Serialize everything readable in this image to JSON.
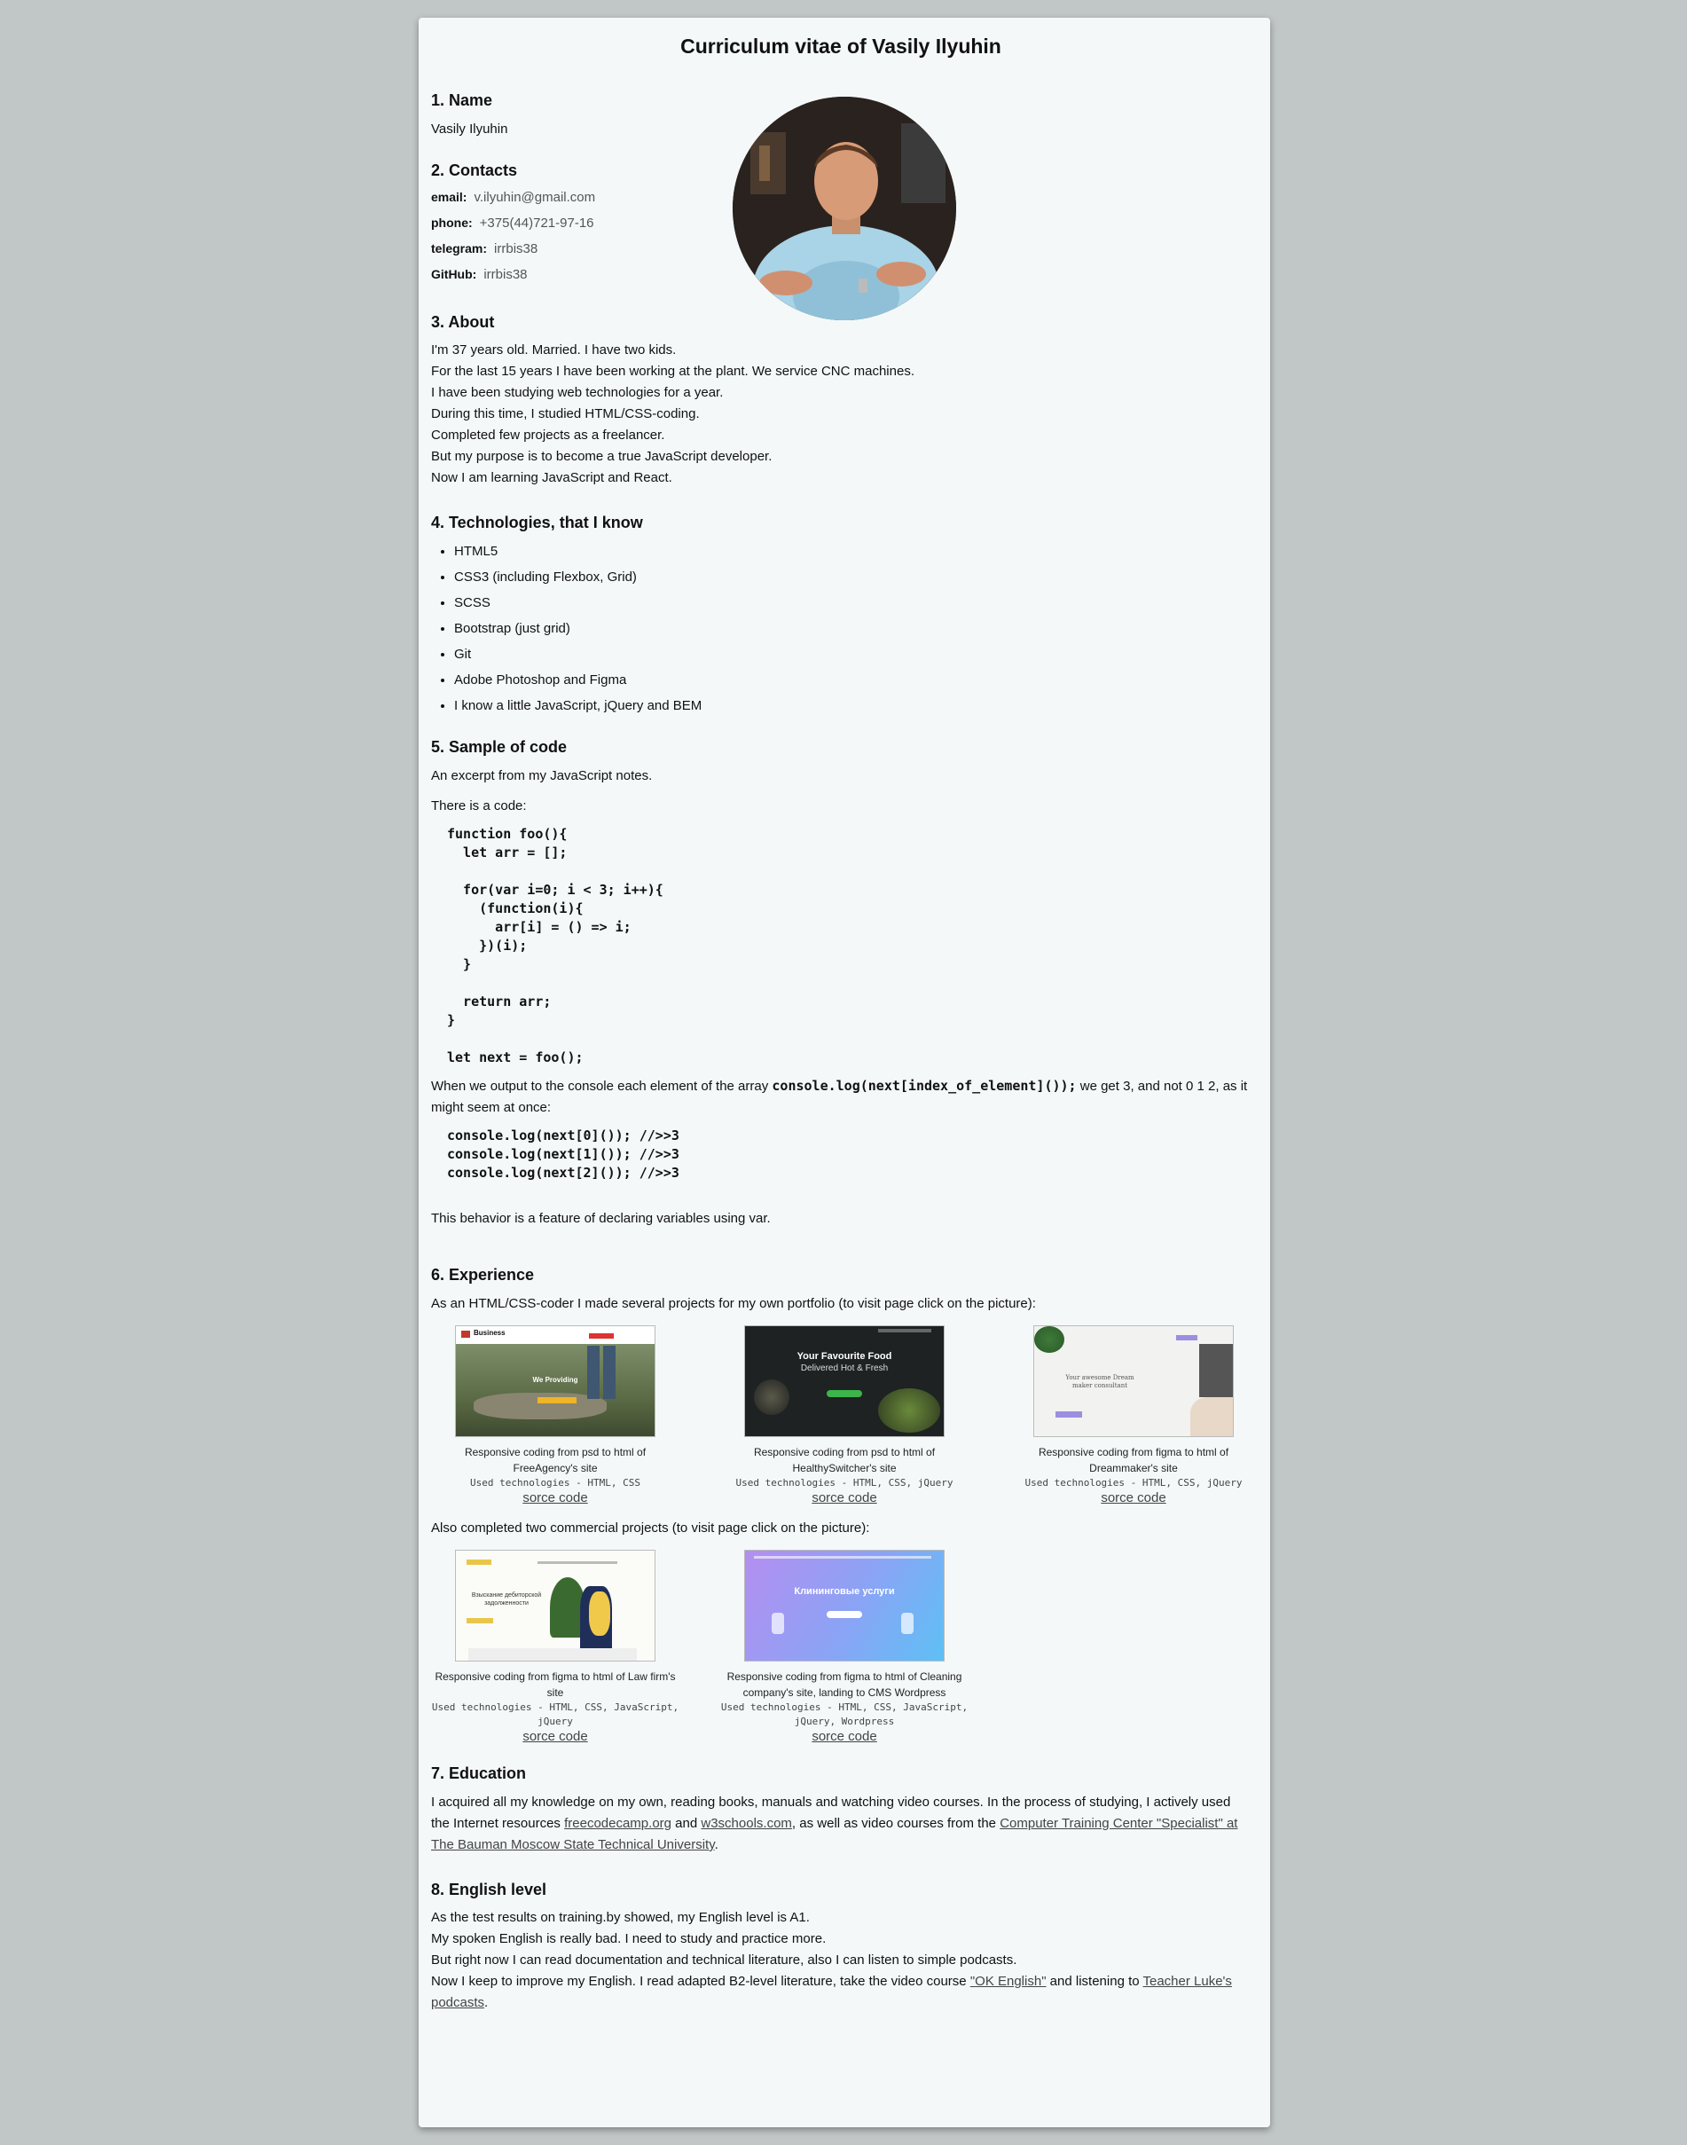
{
  "title": "Curriculum vitae of Vasily Ilyuhin",
  "name_section": {
    "heading": "1. Name",
    "value": "Vasily Ilyuhin"
  },
  "contacts": {
    "heading": "2. Contacts",
    "items": [
      {
        "label": "email:",
        "value": "v.ilyuhin@gmail.com"
      },
      {
        "label": "phone:",
        "value": "+375(44)721-97-16"
      },
      {
        "label": "telegram:",
        "value": "irrbis38"
      },
      {
        "label": "GitHub:",
        "value": "irrbis38"
      }
    ]
  },
  "about": {
    "heading": "3. About",
    "lines": [
      "I'm 37 years old. Married. I have two kids.",
      "For the last 15 years I have been working at the plant. We service CNC machines.",
      "I have been studying web technologies for a year.",
      "During this time, I studied HTML/CSS-coding.",
      "Completed few projects as a freelancer.",
      "But my purpose is to become a true JavaScript developer.",
      "Now I am learning JavaScript and React."
    ]
  },
  "technologies": {
    "heading": "4. Technologies, that I know",
    "items": [
      "HTML5",
      "CSS3 (including Flexbox, Grid)",
      "SCSS",
      "Bootstrap (just grid)",
      "Git",
      "Adobe Photoshop and Figma",
      "I know a little JavaScript, jQuery and BEM"
    ]
  },
  "sample": {
    "heading": "5. Sample of code",
    "intro": "An excerpt from my JavaScript notes.",
    "there": "There is a code:",
    "code": "function foo(){\n  let arr = [];\n\n  for(var i=0; i < 3; i++){\n    (function(i){\n      arr[i] = () => i;\n    })(i);\n  }\n\n  return arr;\n}\n\nlet next = foo();",
    "explain_pre": "When we output to the console each element of the array ",
    "explain_code": "console.log(next[index_of_element]());",
    "explain_post": " we get 3, and not 0 1 2, as it might seem at once:",
    "code2": "console.log(next[0]()); //>>3\nconsole.log(next[1]()); //>>3\nconsole.log(next[2]()); //>>3",
    "conclusion": "This behavior is a feature of declaring variables using var."
  },
  "experience": {
    "heading": "6. Experience",
    "intro": "As an HTML/CSS-coder I made several projects for my own portfolio (to visit page click on the picture):",
    "projects": [
      {
        "caption": "Responsive coding from psd to html of FreeAgency's site",
        "tech": "Used technologies - HTML, CSS",
        "link": "sorce code",
        "thumb_brand": "Business",
        "thumb_text": "We Providing"
      },
      {
        "caption": "Responsive coding from psd to html of HealthySwitcher's site",
        "tech": "Used technologies - HTML, CSS, jQuery",
        "link": "sorce code",
        "thumb_line1": "Your Favourite Food",
        "thumb_line2": "Delivered Hot & Fresh"
      },
      {
        "caption": "Responsive coding from figma to html of Dreammaker's site",
        "tech": "Used technologies - HTML, CSS, jQuery",
        "link": "sorce code",
        "thumb_text": "Your awesome Dream maker consultant"
      }
    ],
    "commercial_intro": "Also completed two commercial projects (to visit page click on the picture):",
    "commercial": [
      {
        "caption": "Responsive coding from figma to html of Law firm's site",
        "tech": "Used technologies - HTML, CSS, JavaScript, jQuery",
        "link": "sorce code",
        "thumb_text": "Взыскание дебиторской задолженности"
      },
      {
        "caption": "Responsive coding from figma to html of Cleaning company's site, landing to CMS Wordpress",
        "tech": "Used technologies - HTML, CSS, JavaScript, jQuery, Wordpress",
        "link": "sorce code",
        "thumb_text": "Клининговые услуги"
      }
    ]
  },
  "education": {
    "heading": "7. Education",
    "t1": "I acquired all my knowledge on my own, reading books, manuals and watching video courses. In the process of studying, I actively used the Internet resources ",
    "link1": "freecodecamp.org",
    "t2": " and ",
    "link2": "w3schools.com",
    "t3": ", as well as video courses from the ",
    "link3": "Computer Training Center \"Specialist\" at The Bauman Moscow State Technical University",
    "t4": "."
  },
  "english": {
    "heading": "8. English level",
    "lines": [
      "As the test results on training.by showed, my English level is A1.",
      "My spoken English is really bad. I need to study and practice more.",
      "But right now I can read documentation and technical literature, also I can listen to simple podcasts."
    ],
    "last_pre": "Now I keep to improve my English. I read adapted B2-level literature, take the video course ",
    "link1": "\"OK English\"",
    "last_mid": " and listening to ",
    "link2": "Teacher Luke's podcasts",
    "last_post": "."
  }
}
